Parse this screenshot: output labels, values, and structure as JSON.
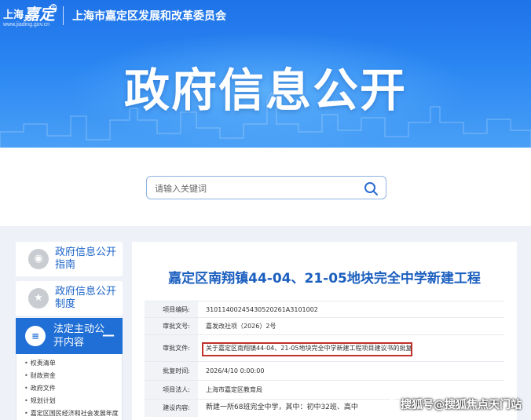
{
  "header": {
    "city": "上海",
    "logo_mark": "嘉定",
    "logo_url": "www.jiading.gov.cn",
    "org_name": "上海市嘉定区发展和改革委员会",
    "hero_title": "政府信息公开"
  },
  "search": {
    "placeholder": "请输入关键词"
  },
  "sidebar": {
    "items": [
      {
        "label": "政府信息公开指南",
        "icon": "guide-icon"
      },
      {
        "label": "政府信息公开制度",
        "icon": "policy-icon"
      }
    ],
    "active": {
      "label": "法定主动公开内容",
      "icon": "document-icon",
      "toggle": "—"
    },
    "sub_items": [
      "权责清单",
      "财政资金",
      "政府文件",
      "规划计划",
      "嘉定区国民经济和社会发展年度"
    ]
  },
  "detail": {
    "title": "嘉定区南翔镇44-04、21-05地块完全中学新建工程",
    "rows": [
      {
        "key": "项目编码:",
        "value": "310114002454305202​61A3101002"
      },
      {
        "key": "审批文号:",
        "value": "嘉发改社项（2026）2号"
      },
      {
        "key": "审批文件:",
        "value": "关于嘉定区南翔镇44-04、21-05地块完全中学新建工程项目建议书的批复"
      },
      {
        "key": "批复时间:",
        "value": "2026/4/10 0:00:00"
      },
      {
        "key": "项目法人:",
        "value": "上海市嘉定区教育局"
      },
      {
        "key": "建设内容:",
        "value": "新建一所68班完全中学，其中：初中32班、高中"
      }
    ]
  },
  "watermark": "搜狐号@搜狐焦点天门站"
}
